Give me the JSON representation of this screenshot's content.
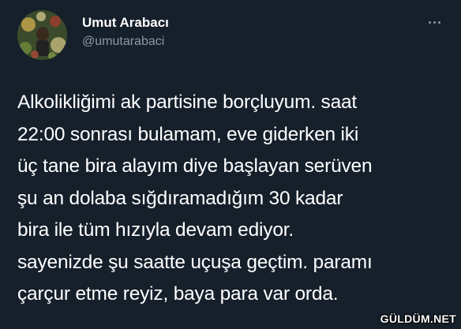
{
  "author": {
    "display_name": "Umut Arabacı",
    "handle": "@umutarabaci"
  },
  "menu": {
    "icon": "more-horizontal-icon"
  },
  "tweet": {
    "text": "Alkolikliğimi ak partisine borçluyum. saat\n22:00 sonrası bulamam, eve giderken iki\nüç tane bira alayım diye başlayan serüven\nşu an dolaba sığdıramadığım 30 kadar\nbira ile tüm hızıyla devam ediyor.\nsayenizde şu saatte uçuşa geçtim. paramı\nçarçur etme reyiz, baya para var orda."
  },
  "watermark": {
    "text": "GÜLDÜM.NET"
  },
  "colors": {
    "background": "#15202b",
    "primary_text": "#ffffff",
    "secondary_text": "#8b98a5"
  }
}
